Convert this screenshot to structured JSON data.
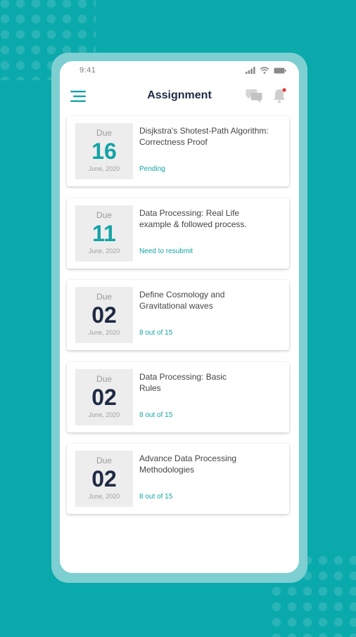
{
  "status_bar": {
    "time": "9:41"
  },
  "header": {
    "title": "Assignment"
  },
  "icons": {
    "menu": "hamburger-menu-icon",
    "chat": "chat-bubbles-icon",
    "notifications": "bell-icon"
  },
  "colors": {
    "accent": "#14a3a6",
    "background": "#0aa9ac",
    "navy": "#1f2a44",
    "notification_dot": "#e53935"
  },
  "assignments": [
    {
      "due_label": "Due",
      "day": "16",
      "month_year": "June, 2020",
      "title": "Disjkstra's Shotest-Path Algorithm: Correctness Proof",
      "status": "Pending",
      "day_color": "teal"
    },
    {
      "due_label": "Due",
      "day": "11",
      "month_year": "June, 2020",
      "title": "Data Processing: Real Life example & followed process.",
      "status": "Need to resubmit",
      "day_color": "teal"
    },
    {
      "due_label": "Due",
      "day": "02",
      "month_year": "June, 2020",
      "title": "Define Cosmology and Gravitational waves",
      "status": "8 out of 15",
      "day_color": "navy"
    },
    {
      "due_label": "Due",
      "day": "02",
      "month_year": "June, 2020",
      "title": "Data Processing: Basic Rules",
      "status": "8 out of 15",
      "day_color": "navy"
    },
    {
      "due_label": "Due",
      "day": "02",
      "month_year": "June, 2020",
      "title": "Advance Data Processing Methodologies",
      "status": "8 out of 15",
      "day_color": "navy"
    }
  ]
}
